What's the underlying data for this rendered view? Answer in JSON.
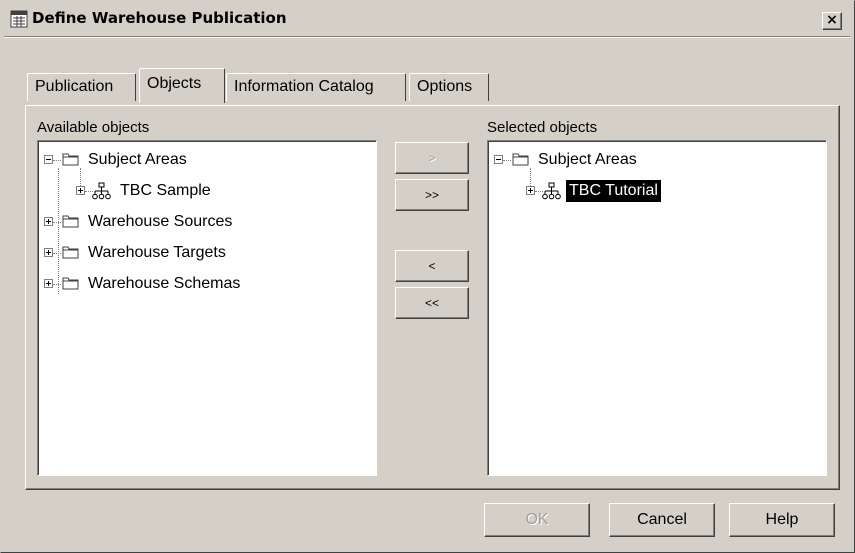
{
  "window": {
    "title": "Define Warehouse Publication",
    "close_label": "×"
  },
  "tabs": [
    {
      "label": "Publication",
      "active": false
    },
    {
      "label": "Objects",
      "active": true
    },
    {
      "label": "Information Catalog",
      "active": false
    },
    {
      "label": "Options",
      "active": false
    }
  ],
  "available": {
    "label": "Available objects",
    "items": [
      {
        "label": "Subject Areas",
        "icon": "folder-icon",
        "expanded": true
      },
      {
        "label": "TBC Sample",
        "icon": "hierarchy-icon",
        "expanded": false
      },
      {
        "label": "Warehouse Sources",
        "icon": "folder-icon",
        "expanded": false
      },
      {
        "label": "Warehouse Targets",
        "icon": "folder-icon",
        "expanded": false
      },
      {
        "label": "Warehouse Schemas",
        "icon": "folder-icon",
        "expanded": false
      }
    ]
  },
  "selected": {
    "label": "Selected objects",
    "items": [
      {
        "label": "Subject Areas",
        "icon": "folder-icon",
        "expanded": true
      },
      {
        "label": "TBC Tutorial",
        "icon": "hierarchy-icon",
        "expanded": false,
        "selected": true
      }
    ]
  },
  "transfer": {
    "add": ">",
    "add_all": ">>",
    "remove": "<",
    "remove_all": "<<"
  },
  "footer": {
    "ok": "OK",
    "cancel": "Cancel",
    "help": "Help"
  }
}
